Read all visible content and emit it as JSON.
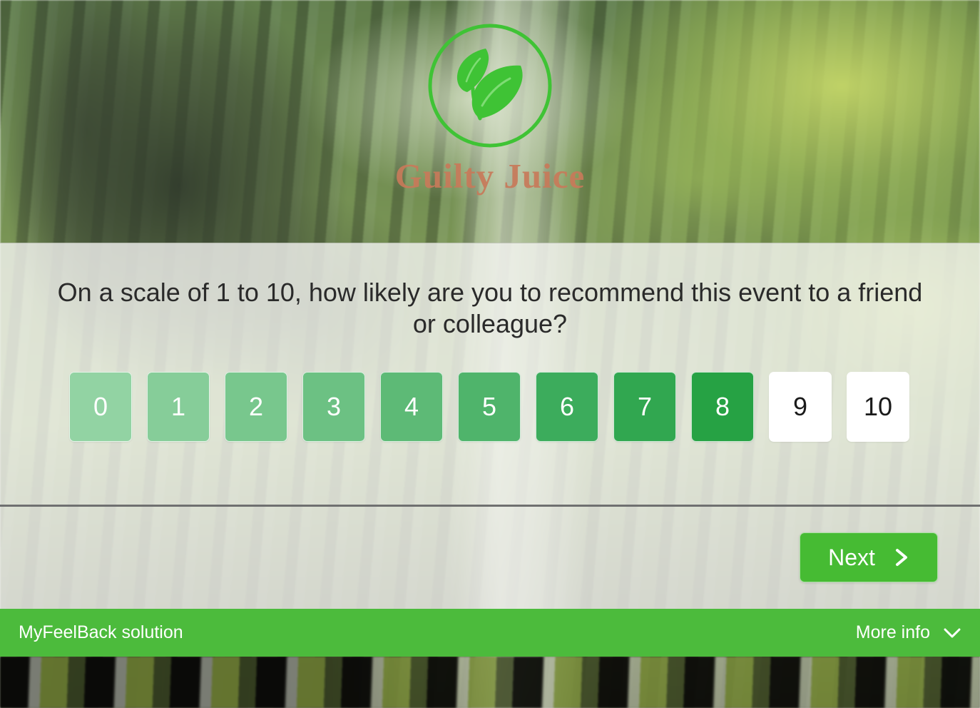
{
  "brand": {
    "name": "Guilty Juice",
    "logo_icon": "leaf-circle-logo-icon",
    "name_color": "#c87a5a",
    "logo_color": "#3fc335"
  },
  "survey": {
    "question": "On a scale of 1 to 10, how likely are you to recommend this event to a friend or colleague?",
    "scale": {
      "options": [
        {
          "label": "0",
          "state": "filled",
          "color": "#92d3a3"
        },
        {
          "label": "1",
          "state": "filled",
          "color": "#86cd99"
        },
        {
          "label": "2",
          "state": "filled",
          "color": "#78c78d"
        },
        {
          "label": "3",
          "state": "filled",
          "color": "#6cc183"
        },
        {
          "label": "4",
          "state": "filled",
          "color": "#5dba76"
        },
        {
          "label": "5",
          "state": "filled",
          "color": "#4fb46b"
        },
        {
          "label": "6",
          "state": "filled",
          "color": "#3cac5c"
        },
        {
          "label": "7",
          "state": "filled",
          "color": "#31a750"
        },
        {
          "label": "8",
          "state": "filled",
          "color": "#26a244"
        },
        {
          "label": "9",
          "state": "empty",
          "color": "#ffffff"
        },
        {
          "label": "10",
          "state": "empty",
          "color": "#ffffff"
        }
      ]
    }
  },
  "actions": {
    "next_label": "Next",
    "next_icon": "chevron-right-icon",
    "next_color": "#46bb33"
  },
  "footer": {
    "brand_text": "MyFeelBack solution",
    "more_info_label": "More info",
    "more_info_icon": "chevron-down-icon",
    "bar_color": "#4cbb3c"
  }
}
